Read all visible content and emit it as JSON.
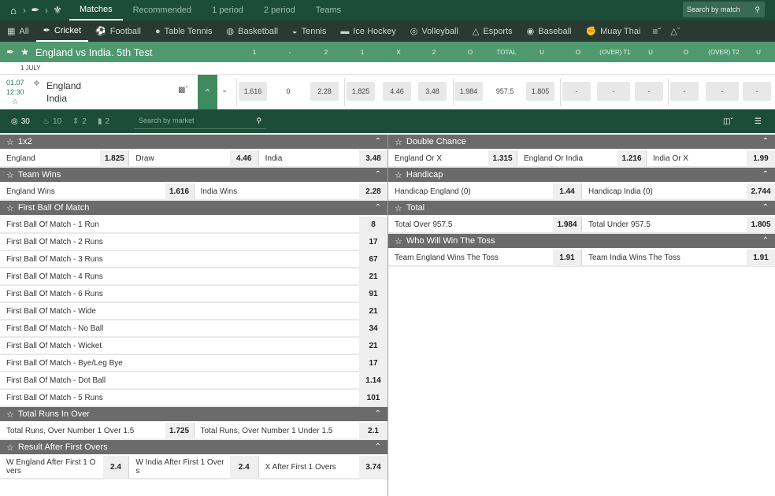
{
  "topnav": {
    "tabs": [
      "Matches",
      "Recommended",
      "1 period",
      "2 period",
      "Teams"
    ],
    "search_placeholder": "Search by match"
  },
  "sportnav": [
    {
      "label": "All",
      "icon": "grid-icon"
    },
    {
      "label": "Cricket",
      "icon": "cricket-icon",
      "active": true
    },
    {
      "label": "Football",
      "icon": "football-icon"
    },
    {
      "label": "Table Tennis",
      "icon": "table-tennis-icon"
    },
    {
      "label": "Basketball",
      "icon": "basketball-icon"
    },
    {
      "label": "Tennis",
      "icon": "tennis-icon"
    },
    {
      "label": "Ice Hockey",
      "icon": "ice-hockey-icon"
    },
    {
      "label": "Volleyball",
      "icon": "volleyball-icon"
    },
    {
      "label": "Esports",
      "icon": "esports-icon"
    },
    {
      "label": "Baseball",
      "icon": "baseball-icon"
    },
    {
      "label": "Muay Thai",
      "icon": "muay-thai-icon"
    }
  ],
  "match": {
    "title": "England vs India. 5th Test",
    "columns": [
      "1",
      "-",
      "2",
      "1",
      "X",
      "2",
      "O",
      "TOTAL",
      "U",
      "O",
      "(OVER) T1",
      "U",
      "O",
      "(OVER) T2",
      "U"
    ],
    "date_label": "1 JULY",
    "date": "01.07",
    "time": "12:30",
    "team1": "England",
    "team2": "India",
    "odds": [
      "1.616",
      "0",
      "2.28",
      "1.825",
      "4.46",
      "3.48",
      "1.984",
      "957.5",
      "1.805",
      "-",
      "-",
      "-",
      "-",
      "-",
      "-"
    ]
  },
  "toolbar": {
    "count_all": "30",
    "count_hot": "10",
    "count_updown": "2",
    "count_bars": "2",
    "search_placeholder": "Search by market"
  },
  "markets_left": [
    {
      "title": "1x2",
      "rows": [
        [
          {
            "label": "England",
            "odd": "1.825"
          },
          {
            "label": "Draw",
            "odd": "4.46"
          },
          {
            "label": "India",
            "odd": "3.48"
          }
        ]
      ]
    },
    {
      "title": "Team Wins",
      "rows": [
        [
          {
            "label": "England Wins",
            "odd": "1.616"
          },
          {
            "label": "India Wins",
            "odd": "2.28"
          }
        ]
      ]
    },
    {
      "title": "First Ball Of Match",
      "rows": [
        [
          {
            "label": "First Ball Of Match - 1 Run",
            "odd": "8"
          }
        ],
        [
          {
            "label": "First Ball Of Match - 2 Runs",
            "odd": "17"
          }
        ],
        [
          {
            "label": "First Ball Of Match - 3 Runs",
            "odd": "67"
          }
        ],
        [
          {
            "label": "First Ball Of Match - 4 Runs",
            "odd": "21"
          }
        ],
        [
          {
            "label": "First Ball Of Match - 6 Runs",
            "odd": "91"
          }
        ],
        [
          {
            "label": "First Ball Of Match - Wide",
            "odd": "21"
          }
        ],
        [
          {
            "label": "First Ball Of Match - No Ball",
            "odd": "34"
          }
        ],
        [
          {
            "label": "First Ball Of Match - Wicket",
            "odd": "21"
          }
        ],
        [
          {
            "label": "First Ball Of Match - Bye/Leg Bye",
            "odd": "17"
          }
        ],
        [
          {
            "label": "First Ball Of Match - Dot Ball",
            "odd": "1.14"
          }
        ],
        [
          {
            "label": "First Ball Of Match - 5 Runs",
            "odd": "101"
          }
        ]
      ]
    },
    {
      "title": "Total Runs In Over",
      "rows": [
        [
          {
            "label": "Total Runs, Over Number 1 Over 1.5",
            "odd": "1.725"
          },
          {
            "label": "Total Runs, Over Number 1 Under 1.5",
            "odd": "2.1"
          }
        ]
      ]
    },
    {
      "title": "Result After First Overs",
      "tall": true,
      "rows": [
        [
          {
            "label": "W England After First 1 O vers",
            "odd": "2.4"
          },
          {
            "label": "W India After First 1 Over s",
            "odd": "2.4"
          },
          {
            "label": "X After First 1 Overs",
            "odd": "3.74"
          }
        ]
      ]
    }
  ],
  "markets_right": [
    {
      "title": "Double Chance",
      "rows": [
        [
          {
            "label": "England Or X",
            "odd": "1.315"
          },
          {
            "label": "England Or India",
            "odd": "1.216"
          },
          {
            "label": "India Or X",
            "odd": "1.99"
          }
        ]
      ]
    },
    {
      "title": "Handicap",
      "rows": [
        [
          {
            "label": "Handicap England (0)",
            "odd": "1.44"
          },
          {
            "label": "Handicap India (0)",
            "odd": "2.744"
          }
        ]
      ]
    },
    {
      "title": "Total",
      "rows": [
        [
          {
            "label": "Total Over 957.5",
            "odd": "1.984"
          },
          {
            "label": "Total Under 957.5",
            "odd": "1.805"
          }
        ]
      ]
    },
    {
      "title": "Who Will Win The Toss",
      "rows": [
        [
          {
            "label": "Team England Wins The Toss",
            "odd": "1.91"
          },
          {
            "label": "Team India Wins The Toss",
            "odd": "1.91"
          }
        ]
      ]
    }
  ]
}
